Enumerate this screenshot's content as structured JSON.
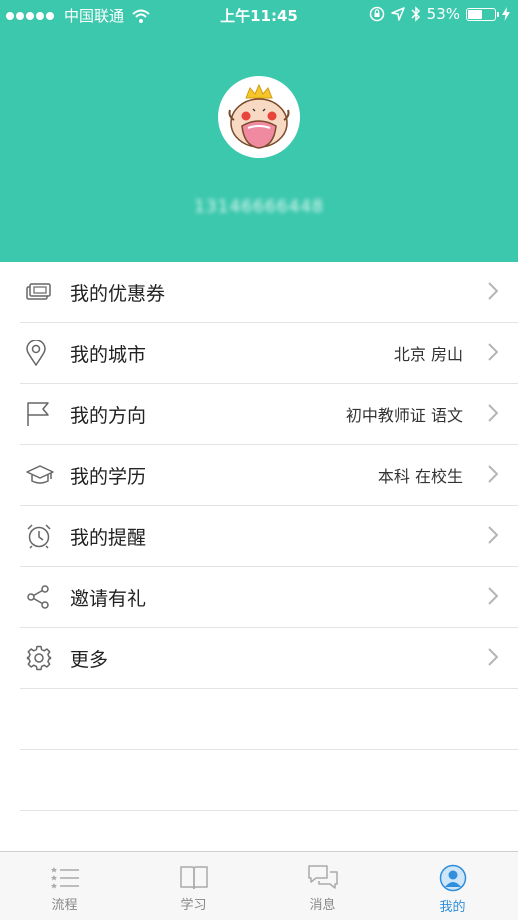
{
  "status_bar": {
    "carrier": "中国联通",
    "time": "上午11:45",
    "battery": "53%",
    "battery_level": 0.53
  },
  "profile": {
    "phone": "13146666448"
  },
  "menu": {
    "items": [
      {
        "label": "我的优惠券",
        "value": "",
        "icon": "coupon-icon"
      },
      {
        "label": "我的城市",
        "value": "北京 房山",
        "icon": "location-pin-icon"
      },
      {
        "label": "我的方向",
        "value": "初中教师证 语文",
        "icon": "flag-icon"
      },
      {
        "label": "我的学历",
        "value": "本科 在校生",
        "icon": "graduation-cap-icon"
      },
      {
        "label": "我的提醒",
        "value": "",
        "icon": "alarm-clock-icon"
      },
      {
        "label": "邀请有礼",
        "value": "",
        "icon": "share-icon"
      },
      {
        "label": "更多",
        "value": "",
        "icon": "gear-icon"
      }
    ]
  },
  "tabbar": {
    "tabs": [
      {
        "label": "流程",
        "icon": "list-icon",
        "active": false
      },
      {
        "label": "学习",
        "icon": "book-icon",
        "active": false
      },
      {
        "label": "消息",
        "icon": "chat-icon",
        "active": false
      },
      {
        "label": "我的",
        "icon": "profile-icon",
        "active": true
      }
    ]
  },
  "colors": {
    "header_bg": "#3cc8ad",
    "active_tab": "#2f8fdc",
    "divider": "#e3e3e3"
  }
}
